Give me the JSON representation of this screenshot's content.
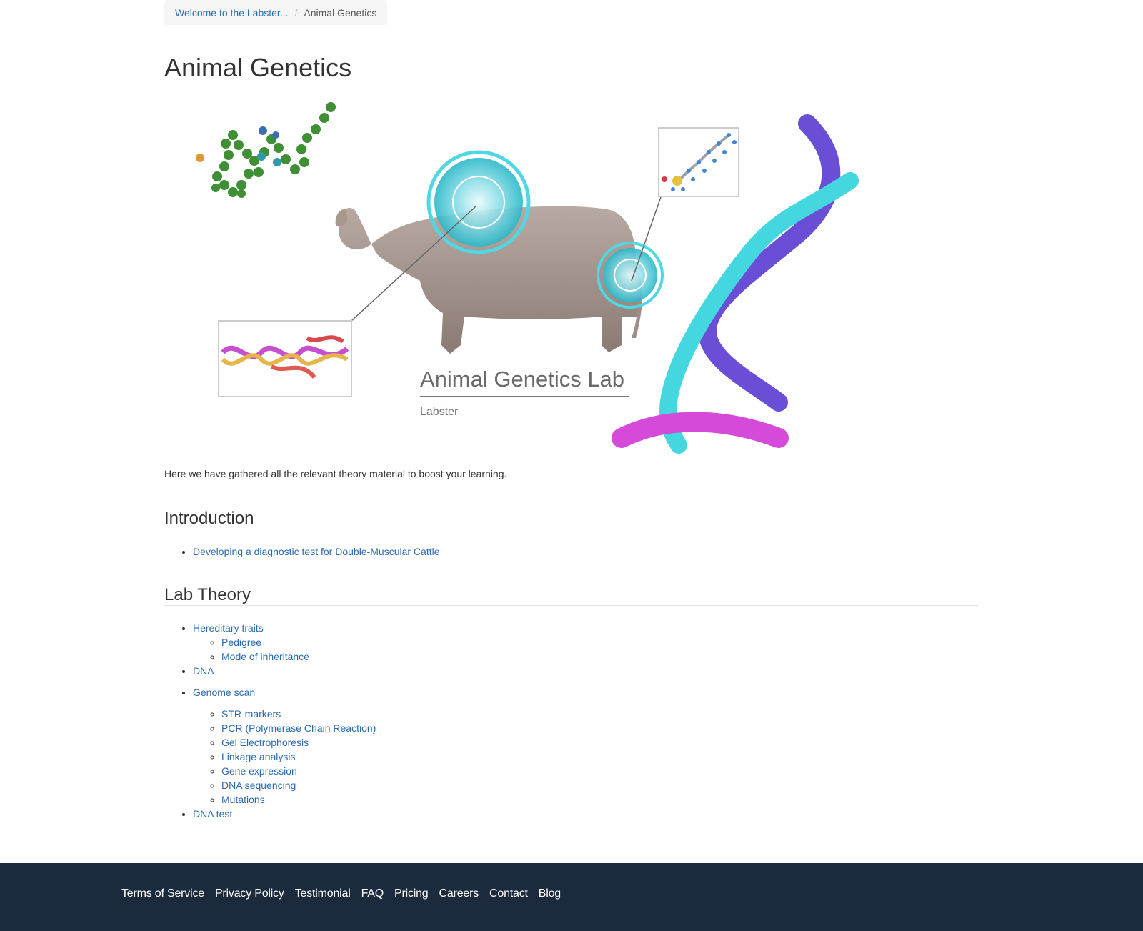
{
  "breadcrumb": {
    "home_label": "Welcome to the Labster...",
    "separator": "/",
    "current_label": "Animal Genetics"
  },
  "page": {
    "title": "Animal Genetics",
    "intro": "Here we have gathered all the relevant theory material to boost your learning."
  },
  "hero": {
    "title": "Animal Genetics Lab",
    "subtitle": "Labster"
  },
  "introduction": {
    "heading": "Introduction",
    "items": [
      "Developing a diagnostic test for Double-Muscular Cattle"
    ]
  },
  "lab_theory": {
    "heading": "Lab Theory",
    "hereditary": {
      "label": "Hereditary traits",
      "children": [
        "Pedigree",
        "Mode of inheritance"
      ]
    },
    "dna": "DNA",
    "genome_scan": {
      "label": "Genome scan",
      "children": [
        "STR-markers",
        "PCR (Polymerase Chain Reaction)",
        "Gel Electrophoresis",
        "Linkage analysis",
        "Gene expression",
        "DNA sequencing",
        "Mutations"
      ]
    },
    "dna_test": "DNA test"
  },
  "footer": {
    "links": [
      "Terms of Service",
      "Privacy Policy",
      "Testimonial",
      "FAQ",
      "Pricing",
      "Careers",
      "Contact",
      "Blog"
    ]
  },
  "colors": {
    "link": "#2a6ab0",
    "footer_bg": "#1b2a3c",
    "text": "#333333"
  }
}
